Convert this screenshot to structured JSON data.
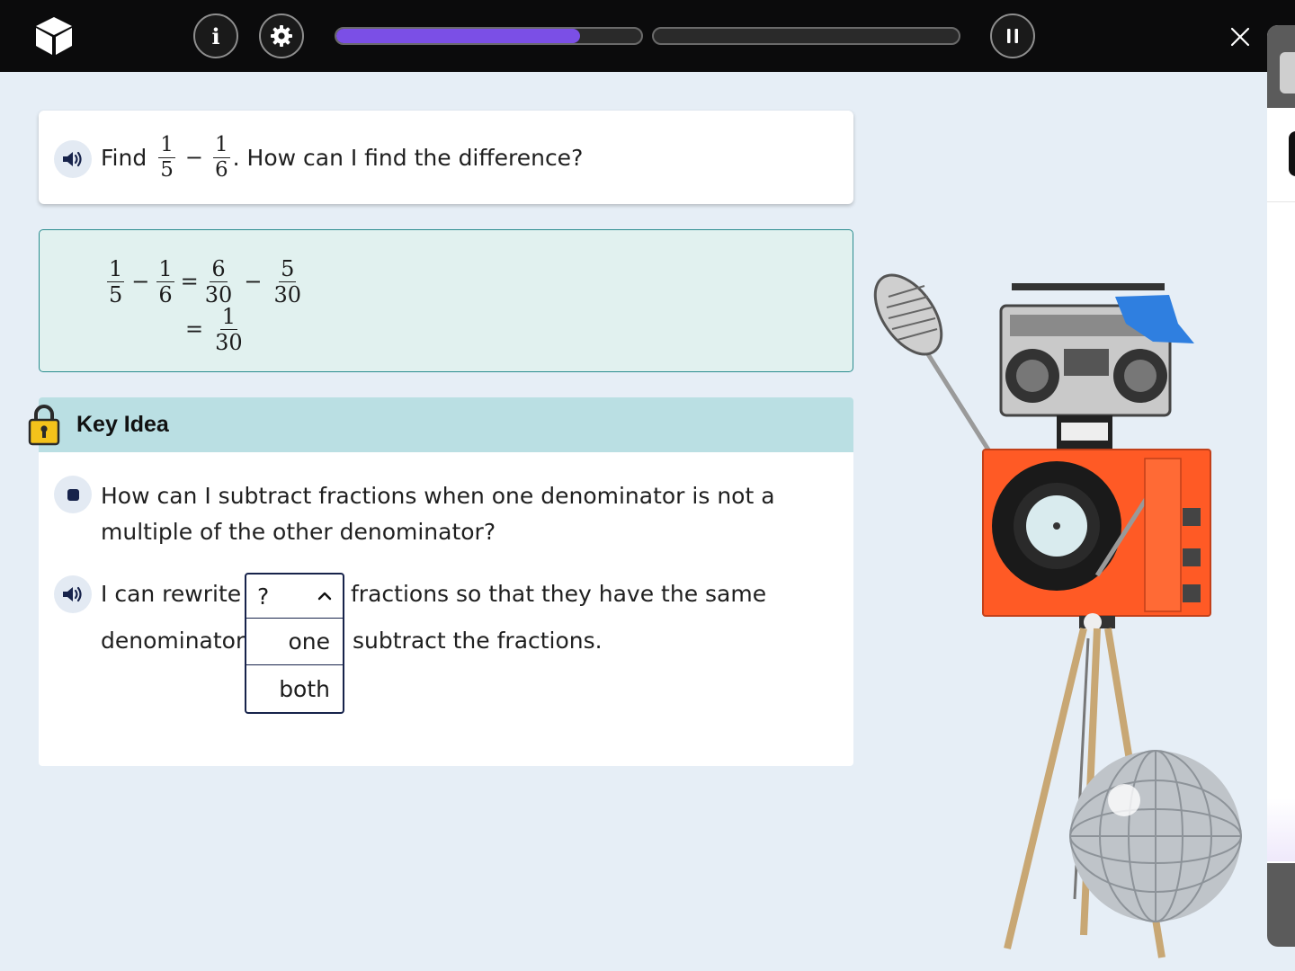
{
  "topbar": {
    "info_label": "i",
    "progress_segments": [
      0.8,
      0.0
    ]
  },
  "question": {
    "prefix": "Find",
    "frac_a": {
      "num": "1",
      "den": "5"
    },
    "operator": "−",
    "frac_b": {
      "num": "1",
      "den": "6"
    },
    "suffix": ". How can I find the difference?"
  },
  "work": {
    "line1": {
      "a": {
        "num": "1",
        "den": "5"
      },
      "b": {
        "num": "1",
        "den": "6"
      },
      "c": {
        "num": "6",
        "den": "30"
      },
      "d": {
        "num": "5",
        "den": "30"
      }
    },
    "line2": {
      "result": {
        "num": "1",
        "den": "30"
      }
    },
    "minus": "−",
    "equals": "="
  },
  "key_idea": {
    "title": "Key Idea",
    "question": "How can I subtract fractions when one denominator is not a multiple of the other denominator?",
    "sentence_part1": "I can rewrite",
    "sentence_part2": "fractions so that they have the same",
    "sentence_part3": "denominator",
    "sentence_part4": "subtract the fractions.",
    "dropdown": {
      "selected": "?",
      "options": [
        "one",
        "both"
      ]
    }
  },
  "colors": {
    "progress_fill": "#7b4fe6",
    "topbar": "#0b0b0c",
    "work_bg": "#e1f1ef",
    "key_header": "#badfe3",
    "navy": "#17234b"
  }
}
